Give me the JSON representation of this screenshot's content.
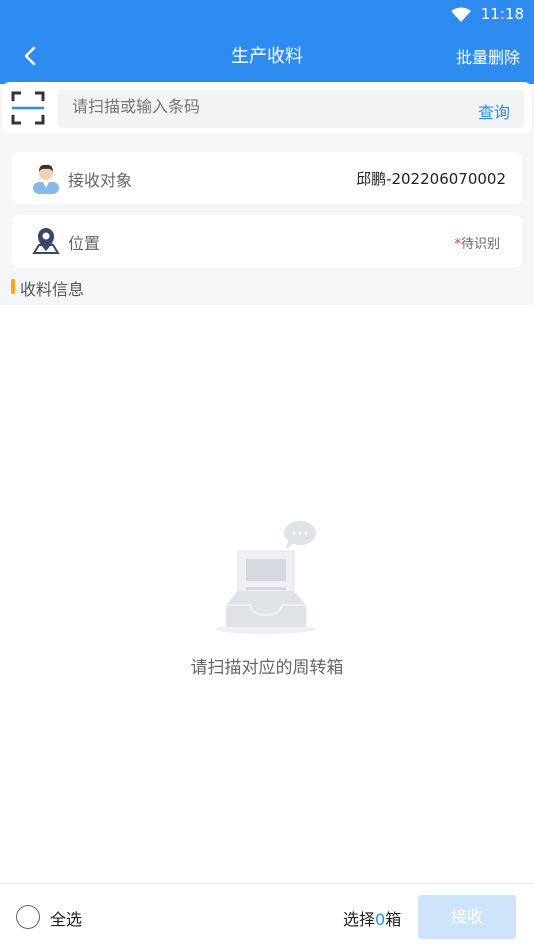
{
  "status": {
    "time": "11:18"
  },
  "nav": {
    "title": "生产收料",
    "right_action": "批量删除"
  },
  "search": {
    "placeholder": "请扫描或输入条码",
    "value": "",
    "button": "查询"
  },
  "receiver": {
    "label": "接收对象",
    "value": "邱鹏-202206070002"
  },
  "location": {
    "label": "位置",
    "star": "*",
    "hint": "待识别"
  },
  "section": {
    "title": "收料信息"
  },
  "empty": {
    "text": "请扫描对应的周转箱"
  },
  "footer": {
    "select_all": "全选",
    "select_prefix": "选择",
    "count": "0",
    "unit": "箱",
    "receive_button": "接收"
  },
  "colors": {
    "primary": "#2e8cf0",
    "accent": "#f5a623",
    "required_star": "#e0443c",
    "disabled_button": "#cfe4fb"
  }
}
